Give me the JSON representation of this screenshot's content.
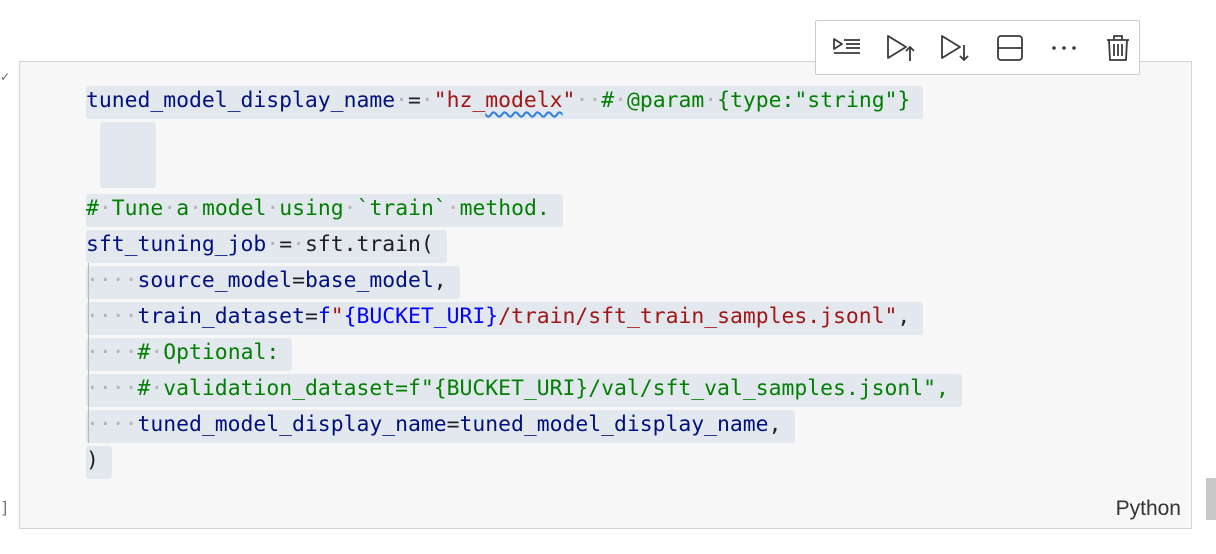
{
  "gutter": {
    "check": "✓",
    "bracket": "]"
  },
  "toolbar": {
    "buttons": [
      {
        "name": "run-by-line-icon"
      },
      {
        "name": "execute-above-cells-icon"
      },
      {
        "name": "execute-cell-and-below-icon"
      },
      {
        "name": "split-cell-icon"
      },
      {
        "name": "more-actions-icon"
      },
      {
        "name": "delete-cell-icon"
      }
    ]
  },
  "code": {
    "lines": [
      [
        {
          "t": "tuned_model_display_name",
          "c": "id"
        },
        {
          "t": "·",
          "c": "ws"
        },
        {
          "t": "=",
          "c": "fn"
        },
        {
          "t": "·",
          "c": "ws"
        },
        {
          "t": "\"hz_",
          "c": "str"
        },
        {
          "t": "modelx",
          "c": "str squiggle"
        },
        {
          "t": "\"",
          "c": "str"
        },
        {
          "t": "··",
          "c": "ws"
        },
        {
          "t": "#",
          "c": "cm"
        },
        {
          "t": "·",
          "c": "ws"
        },
        {
          "t": "@param",
          "c": "cm"
        },
        {
          "t": "·",
          "c": "ws"
        },
        {
          "t": "{type:\"string\"}",
          "c": "cm"
        }
      ],
      [],
      [],
      [
        {
          "t": "#",
          "c": "cm"
        },
        {
          "t": "·",
          "c": "ws"
        },
        {
          "t": "Tune",
          "c": "cm"
        },
        {
          "t": "·",
          "c": "ws"
        },
        {
          "t": "a",
          "c": "cm"
        },
        {
          "t": "·",
          "c": "ws"
        },
        {
          "t": "model",
          "c": "cm"
        },
        {
          "t": "·",
          "c": "ws"
        },
        {
          "t": "using",
          "c": "cm"
        },
        {
          "t": "·",
          "c": "ws"
        },
        {
          "t": "`train`",
          "c": "cm"
        },
        {
          "t": "·",
          "c": "ws"
        },
        {
          "t": "method.",
          "c": "cm"
        }
      ],
      [
        {
          "t": "sft_tuning_job",
          "c": "id"
        },
        {
          "t": "·",
          "c": "ws"
        },
        {
          "t": "=",
          "c": "fn"
        },
        {
          "t": "·",
          "c": "ws"
        },
        {
          "t": "sft.train(",
          "c": "fn"
        }
      ],
      [
        {
          "t": "····",
          "c": "ws"
        },
        {
          "t": "source_model",
          "c": "id"
        },
        {
          "t": "=",
          "c": "fn"
        },
        {
          "t": "base_model",
          "c": "id"
        },
        {
          "t": ",",
          "c": "fn"
        }
      ],
      [
        {
          "t": "····",
          "c": "ws"
        },
        {
          "t": "train_dataset",
          "c": "id"
        },
        {
          "t": "=",
          "c": "fn"
        },
        {
          "t": "f",
          "c": "fp"
        },
        {
          "t": "\"",
          "c": "str"
        },
        {
          "t": "{BUCKET_URI}",
          "c": "fp"
        },
        {
          "t": "/train/sft_train_samples.jsonl\"",
          "c": "str"
        },
        {
          "t": ",",
          "c": "fn"
        }
      ],
      [
        {
          "t": "····",
          "c": "ws"
        },
        {
          "t": "#",
          "c": "cm"
        },
        {
          "t": "·",
          "c": "ws"
        },
        {
          "t": "Optional:",
          "c": "cm"
        }
      ],
      [
        {
          "t": "····",
          "c": "ws"
        },
        {
          "t": "#",
          "c": "cm"
        },
        {
          "t": "·",
          "c": "ws"
        },
        {
          "t": "validation_dataset=f\"{BUCKET_URI}/val/sft_val_samples.jsonl\",",
          "c": "cm"
        }
      ],
      [
        {
          "t": "····",
          "c": "ws"
        },
        {
          "t": "tuned_model_display_name",
          "c": "id"
        },
        {
          "t": "=",
          "c": "fn"
        },
        {
          "t": "tuned_model_display_name",
          "c": "id"
        },
        {
          "t": ",",
          "c": "fn"
        }
      ],
      [
        {
          "t": ")",
          "c": "fn"
        }
      ]
    ]
  },
  "cell": {
    "language": "Python"
  }
}
